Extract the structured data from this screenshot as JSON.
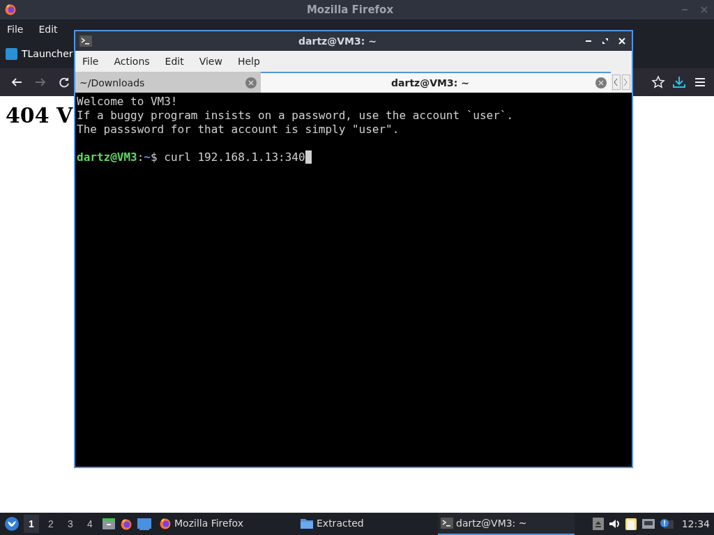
{
  "firefox": {
    "title": "Mozilla Firefox",
    "menu": [
      "File",
      "Edit"
    ],
    "tabs": [
      {
        "label": "TLauncher",
        "selected": true
      }
    ],
    "nav": [
      {
        "kind": "back",
        "disabled": false
      },
      {
        "kind": "forward",
        "disabled": true
      },
      {
        "kind": "reload",
        "disabled": false
      }
    ],
    "heading": "404 V"
  },
  "terminal": {
    "title": "dartz@VM3: ~",
    "menu": [
      "File",
      "Actions",
      "Edit",
      "View",
      "Help"
    ],
    "tabs": [
      {
        "label": "~/Downloads",
        "selected": false
      },
      {
        "label": "dartz@VM3: ~",
        "selected": true
      }
    ],
    "lines": [
      "Welcome to VM3!",
      "If a buggy program insists on a password, use the account `user`.",
      "The passsword for that account is simply \"user\"."
    ],
    "prompt": {
      "user": "dartz@VM3",
      "separator": ":",
      "path": "~",
      "symbol": "$",
      "command": "curl 192.168.1.13:340"
    }
  },
  "taskbar": {
    "workspaces": [
      {
        "label": "1",
        "selected": true
      },
      {
        "label": "2",
        "selected": false
      },
      {
        "label": "3",
        "selected": false
      },
      {
        "label": "4",
        "selected": false
      }
    ],
    "launchers": [
      {
        "kind": "files"
      },
      {
        "kind": "firefox"
      },
      {
        "kind": "desktop"
      }
    ],
    "tasks": [
      {
        "kind": "firefox",
        "label": "Mozilla Firefox",
        "selected": false
      },
      {
        "kind": "folder",
        "label": "Extracted",
        "selected": false
      },
      {
        "kind": "terminal",
        "label": "dartz@VM3: ~",
        "selected": true
      }
    ],
    "tray": [
      {
        "kind": "eject"
      },
      {
        "kind": "volume"
      },
      {
        "kind": "clipboard"
      },
      {
        "kind": "network"
      },
      {
        "kind": "notice"
      }
    ],
    "clock": "12:34"
  }
}
